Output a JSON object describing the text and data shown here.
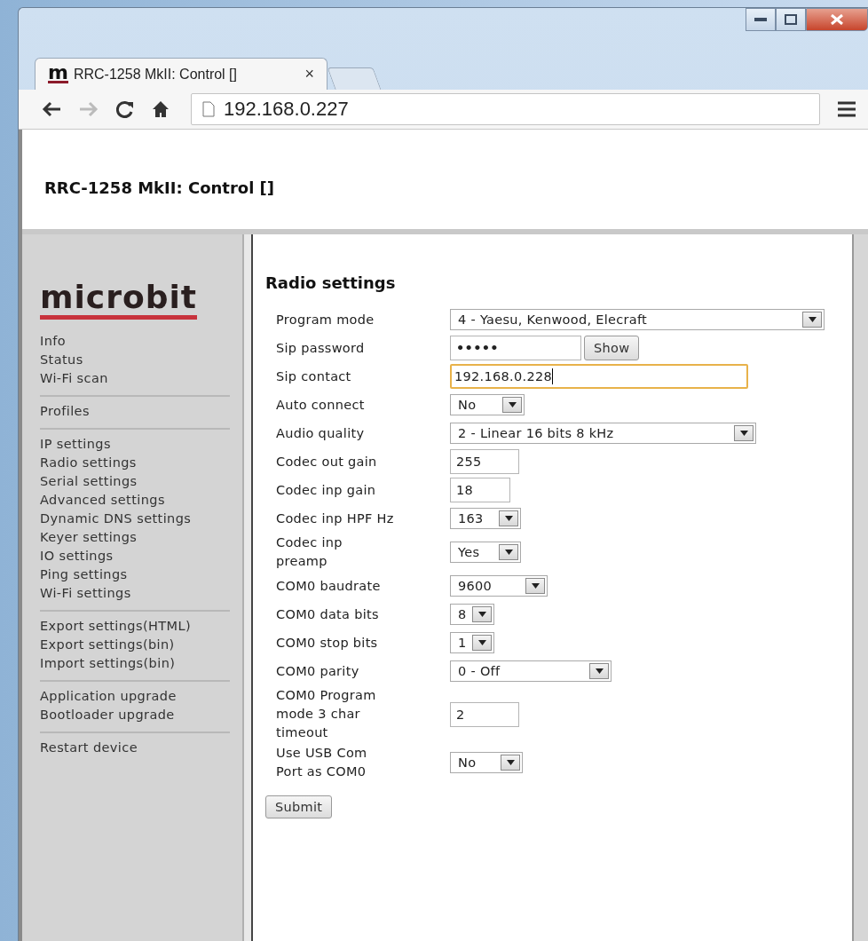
{
  "browser": {
    "tab": {
      "favicon": "m",
      "title": "RRC-1258 MkII: Control []",
      "close": "×"
    },
    "address": "192.168.0.227"
  },
  "header": {
    "title": "RRC-1258 MkII: Control []"
  },
  "sidebar": {
    "logo": "microbit",
    "sections": [
      {
        "items": [
          "Info",
          "Status",
          "Wi-Fi scan"
        ]
      },
      {
        "items": [
          "Profiles"
        ]
      },
      {
        "items": [
          "IP settings",
          "Radio settings",
          "Serial settings",
          "Advanced settings",
          "Dynamic DNS settings",
          "Keyer settings",
          "IO settings",
          "Ping settings",
          "Wi-Fi settings"
        ]
      },
      {
        "items": [
          "Export settings(HTML)",
          "Export settings(bin)",
          "Import settings(bin)"
        ]
      },
      {
        "items": [
          "Application upgrade",
          "Bootloader upgrade"
        ]
      },
      {
        "items": [
          "Restart device"
        ]
      }
    ]
  },
  "form": {
    "title": "Radio settings",
    "fields": [
      {
        "label": "Program mode",
        "kind": "select",
        "value": "4 - Yaesu, Kenwood, Elecraft"
      },
      {
        "label": "Sip password",
        "kind": "password",
        "value": "•••••",
        "button": "Show"
      },
      {
        "label": "Sip contact",
        "kind": "text",
        "value": "192.168.0.228",
        "focused": true
      },
      {
        "label": "Auto connect",
        "kind": "select",
        "value": "No"
      },
      {
        "label": "Audio quality",
        "kind": "select",
        "value": "2 - Linear 16 bits 8 kHz"
      },
      {
        "label": "Codec out gain",
        "kind": "text",
        "value": "255",
        "focused": false
      },
      {
        "label": "Codec inp gain",
        "kind": "text",
        "value": "18",
        "focused": false
      },
      {
        "label": "Codec inp HPF Hz",
        "kind": "select",
        "value": "163"
      },
      {
        "label": "Codec inp preamp",
        "kind": "select",
        "value": "Yes"
      },
      {
        "label": "COM0 baudrate",
        "kind": "select",
        "value": "9600"
      },
      {
        "label": "COM0 data bits",
        "kind": "select",
        "value": "8"
      },
      {
        "label": "COM0 stop bits",
        "kind": "select",
        "value": "1"
      },
      {
        "label": "COM0 parity",
        "kind": "select",
        "value": "0 - Off"
      },
      {
        "label": "COM0 Program mode 3 char timeout",
        "kind": "text",
        "value": "2",
        "focused": false
      },
      {
        "label": "Use USB Com Port as COM0",
        "kind": "select",
        "value": "No"
      }
    ],
    "submit": "Submit"
  }
}
